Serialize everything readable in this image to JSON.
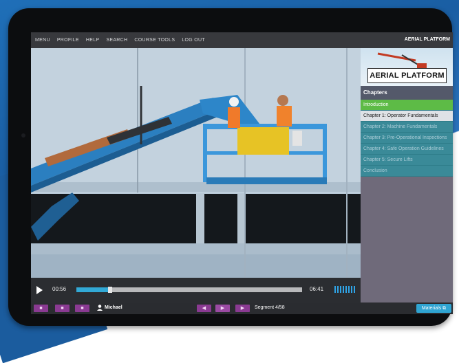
{
  "menu": [
    "MENU",
    "PROFILE",
    "HELP",
    "SEARCH",
    "COURSE TOOLS",
    "LOG OUT"
  ],
  "course_title": "AERIAL PLATFORM",
  "logo_text": "AERIAL PLATFORM",
  "sidebar": {
    "heading": "Chapters",
    "chapters": [
      {
        "label": "Introduction",
        "state": "active"
      },
      {
        "label": "Chapter 1: Operator Fundamentals",
        "state": "current"
      },
      {
        "label": "Chapter 2: Machine Fundamentals",
        "state": "normal"
      },
      {
        "label": "Chapter 3: Pre-Operational Inspections",
        "state": "normal"
      },
      {
        "label": "Chapter 4: Safe Operation Guidelines",
        "state": "normal"
      },
      {
        "label": "Chapter 5: Secure Lifts",
        "state": "normal"
      },
      {
        "label": "Conclusion",
        "state": "normal"
      }
    ]
  },
  "player": {
    "current_time": "00:56",
    "total_time": "06:41",
    "progress_fraction": 0.14,
    "volume_fraction": 1.0
  },
  "footer": {
    "user_name": "Michael",
    "segment_label": "Segment 4/58",
    "materials_label": "Materials"
  },
  "colors": {
    "accent_green": "#5dbb46",
    "chapter_teal": "#3a8a98",
    "progress_blue": "#32a9d6",
    "button_purple": "#8a3a92"
  },
  "icons": [
    "play-icon",
    "user-icon",
    "volume-icon",
    "expand-icon"
  ]
}
